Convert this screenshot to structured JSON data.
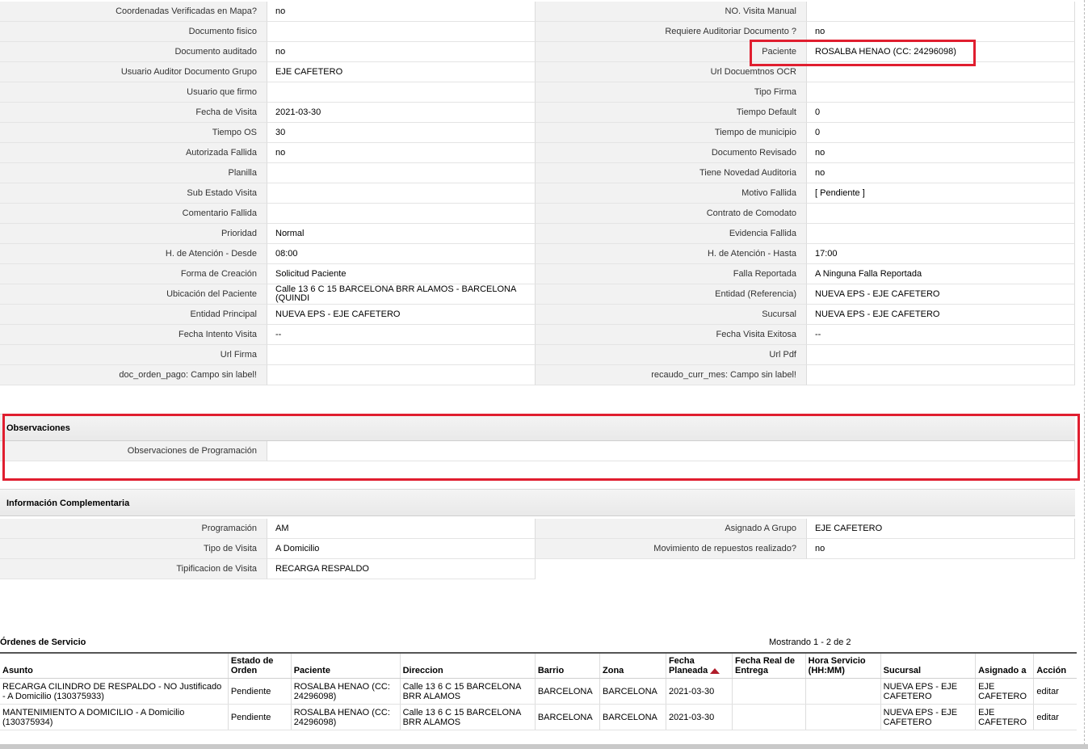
{
  "details": [
    [
      "Coordenadas Verificadas en Mapa?",
      "no",
      "NO. Visita Manual",
      ""
    ],
    [
      "Documento fisico",
      "",
      "Requiere Auditoriar Documento ?",
      "no"
    ],
    [
      "Documento auditado",
      "no",
      "Paciente",
      "ROSALBA HENAO (CC: 24296098)"
    ],
    [
      "Usuario Auditor Documento Grupo",
      "EJE CAFETERO",
      "Url Docuemtnos OCR",
      ""
    ],
    [
      "Usuario que firmo",
      "",
      "Tipo Firma",
      ""
    ],
    [
      "Fecha de Visita",
      "2021-03-30",
      "Tiempo Default",
      "0"
    ],
    [
      "Tiempo OS",
      "30",
      "Tiempo de municipio",
      "0"
    ],
    [
      "Autorizada Fallida",
      "no",
      "Documento Revisado",
      "no"
    ],
    [
      "Planilla",
      "",
      "Tiene Novedad Auditoria",
      "no"
    ],
    [
      "Sub Estado Visita",
      "",
      "Motivo Fallida",
      "[ Pendiente ]"
    ],
    [
      "Comentario Fallida",
      "",
      "Contrato de Comodato",
      ""
    ],
    [
      "Prioridad",
      "Normal",
      "Evidencia Fallida",
      ""
    ],
    [
      "H. de Atención - Desde",
      "08:00",
      "H. de Atención - Hasta",
      "17:00"
    ],
    [
      "Forma de Creación",
      "Solicitud Paciente",
      "Falla Reportada",
      "A Ninguna Falla Reportada"
    ],
    [
      "Ubicación del Paciente",
      "Calle 13 6 C 15 BARCELONA BRR ALAMOS - BARCELONA (QUINDI",
      "Entidad (Referencia)",
      "NUEVA EPS - EJE CAFETERO"
    ],
    [
      "Entidad Principal",
      "NUEVA EPS - EJE CAFETERO",
      "Sucursal",
      "NUEVA EPS - EJE CAFETERO"
    ],
    [
      "Fecha Intento Visita",
      "--",
      "Fecha Visita Exitosa",
      "--"
    ],
    [
      "Url Firma",
      "",
      "Url Pdf",
      ""
    ],
    [
      "doc_orden_pago: Campo sin label!",
      "",
      "recaudo_curr_mes: Campo sin label!",
      ""
    ]
  ],
  "observaciones": {
    "title": "Observaciones",
    "label": "Observaciones de Programación",
    "value": ""
  },
  "complementaria": {
    "title": "Información Complementaria",
    "rows": [
      [
        "Programación",
        "AM",
        "Asignado A Grupo",
        "EJE CAFETERO"
      ],
      [
        "Tipo de Visita",
        "A Domicilio",
        "Movimiento de repuestos realizado?",
        "no"
      ],
      [
        "Tipificacion de Visita",
        "RECARGA RESPALDO",
        null,
        null
      ]
    ]
  },
  "ordenes": {
    "title": "Órdenes de Servicio",
    "showing": "Mostrando 1 - 2 de 2",
    "columns": [
      "Asunto",
      "Estado de Orden",
      "Paciente",
      "Direccion",
      "Barrio",
      "Zona",
      "Fecha Planeada",
      "Fecha Real de Entrega",
      "Hora Servicio (HH:MM)",
      "Sucursal",
      "Asignado a",
      "Acción"
    ],
    "rows": [
      [
        "RECARGA CILINDRO DE RESPALDO - NO Justificado - A Domicilio (130375933)",
        "Pendiente",
        "ROSALBA HENAO (CC: 24296098)",
        "Calle 13 6 C 15 BARCELONA BRR ALAMOS",
        "BARCELONA",
        "BARCELONA",
        "2021-03-30",
        "",
        "",
        "NUEVA EPS - EJE CAFETERO",
        "EJE CAFETERO",
        "editar"
      ],
      [
        "MANTENIMIENTO A DOMICILIO - A Domicilio (130375934)",
        "Pendiente",
        "ROSALBA HENAO (CC: 24296098)",
        "Calle 13 6 C 15 BARCELONA BRR ALAMOS",
        "BARCELONA",
        "BARCELONA",
        "2021-03-30",
        "",
        "",
        "NUEVA EPS - EJE CAFETERO",
        "EJE CAFETERO",
        "editar"
      ]
    ]
  },
  "highlight_color": "#e01e2f"
}
